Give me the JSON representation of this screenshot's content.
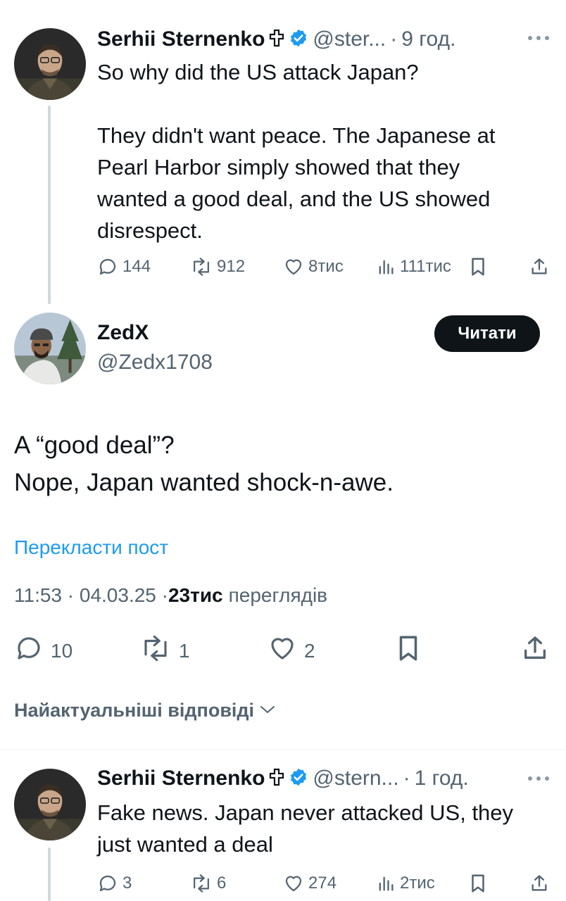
{
  "tweet1": {
    "author_name": "Serhii Sternenko",
    "handle": "@ster...",
    "time": "9 год.",
    "text_lines": [
      "So why did the US attack Japan?",
      "",
      "They didn't want peace. The Japanese at",
      "Pearl Harbor simply showed that they",
      "wanted a good deal, and the US showed",
      "disrespect."
    ],
    "replies": "144",
    "reposts": "912",
    "likes": "8тис",
    "views": "111тис"
  },
  "main_tweet": {
    "author_name": "ZedX",
    "handle": "@Zedx1708",
    "follow_label": "Читати",
    "text_lines": [
      "A “good deal”?",
      "Nope, Japan wanted shock-n-awe."
    ],
    "translate_label": "Перекласти пост",
    "timestamp": "11:53 · 04.03.25 · ",
    "views_count": "23тис",
    "views_label": "переглядів",
    "replies": "10",
    "reposts": "1",
    "likes": "2"
  },
  "replies_sort_label": "Найактуальніші відповіді",
  "tweet2": {
    "author_name": "Serhii Sternenko",
    "handle": "@stern...",
    "time": "1 год.",
    "text_lines": [
      "Fake news. Japan never attacked US, they",
      "just wanted a deal"
    ],
    "replies": "3",
    "reposts": "6",
    "likes": "274",
    "views": "2тис"
  },
  "colors": {
    "text": "#0f1419",
    "secondary": "#536471",
    "link": "#1d9bf0",
    "verified": "#1d9bf0",
    "thread_line": "#cfd9de"
  },
  "icons": {
    "reply": "reply-icon",
    "repost": "repost-icon",
    "like": "heart-icon",
    "views": "views-icon",
    "bookmark": "bookmark-icon",
    "share": "share-icon",
    "verified": "verified-badge-icon",
    "cross": "cross-icon",
    "more": "more-icon",
    "chevron": "chevron-down-icon"
  }
}
